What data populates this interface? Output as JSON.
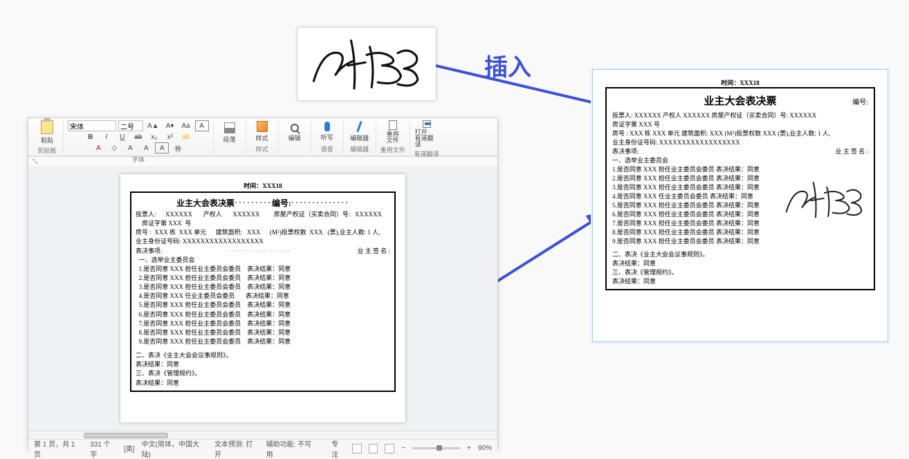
{
  "insert_label": "插入",
  "ribbon": {
    "paste": "粘贴",
    "paragraph": "段落",
    "styles": "样式",
    "find": "编辑",
    "listen": "听写",
    "editor": "编辑器",
    "reuse_files": "重用\n文件",
    "open_add": "打开\n有道翻译",
    "group_clipboard": "剪贴板",
    "group_font": "字体",
    "group_style": "样式",
    "group_lang": "语音",
    "group_editor": "编辑器",
    "group_reuse": "重用文件",
    "group_add": "有道翻译",
    "font_name": "宋体",
    "font_size": "二号",
    "buttons": {
      "b": "B",
      "i": "I",
      "u": "U",
      "ab": "ab",
      "x2": "x₂",
      "x2s": "x²",
      "Aa": "Aa",
      "A": "A",
      "eraser": "◇",
      "Aup": "A",
      "Adn": "A"
    }
  },
  "status": {
    "page": "第 1 页，共 1 页",
    "words": "331 个字",
    "langsym": "[英]",
    "lang": "中文(简体，中国大陆)",
    "pred": "文本预测: 打开",
    "acc": "辅助功能: 不可用",
    "focus": "专注",
    "zoom": "90%"
  },
  "doc": {
    "time_header": "时间：XXX18",
    "title": "业主大会表决票",
    "serial_prefix": "编号:",
    "voter_line": "投票人:      XXXXXX       产权人       XXXXXX         房屋产权证（买卖合同）号:   XXXXXX",
    "deed_line": "    房证字第 XXX  号",
    "room_line": "房号 :  XXX 栋  XXX 单元      建筑面积:   XXX      (M²)投票权数  XXX   (票),业主人数: 1 人,",
    "id_line": "业主身份证号码: XXXXXXXXXXXXXXXXXX",
    "section_items": "表决事项:",
    "owner_sign": "业 主 签 名 :",
    "sec1": "  一、选举业主委员会",
    "votes": [
      "  1.是否同意 XXX 担任业主委员会委员    表决结果：同意",
      "  2.是否同意 XXX 担任业主委员会委员    表决结果：同意",
      "  3.是否同意 XXX 担任业主委员会委员    表决结果：同意",
      "  4.是否同意 XXX 任业主委员会委员       表决结果：同意",
      "  5.是否同意 XXX 担任业主委员会委员    表决结果：同意",
      "  6.是否同意 XXX 担任业主委员会委员    表决结果：同意",
      "  7.是否同意 XXX 担任业主委员会委员    表决结果：同意",
      "  8.是否同意 XXX 担任业主委员会委员    表决结果：同意",
      "  9.是否同意 XXX 担任业主委员会委员    表决结果：同意"
    ],
    "sec2": "二、表决《业主大会会议事规则》。",
    "res2": "表决结果：同意",
    "sec3": "三、表决《管理规约》。",
    "res3": "表决结果：同意"
  }
}
